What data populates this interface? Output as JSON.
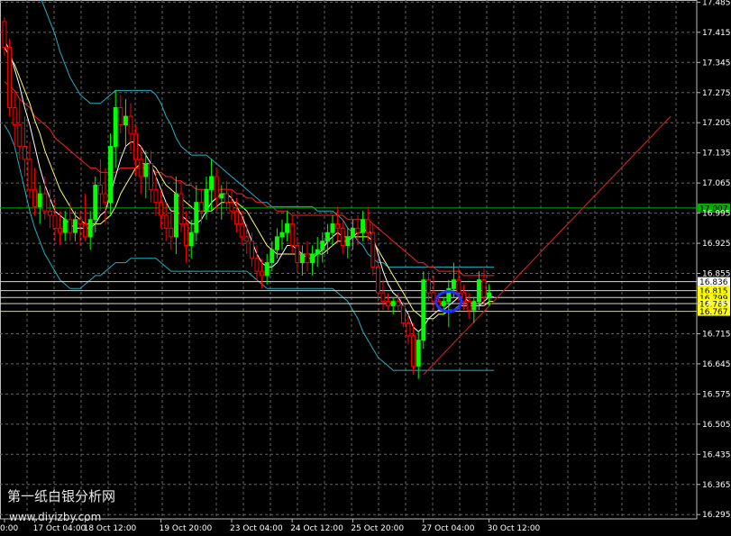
{
  "chart_data": {
    "type": "candlestick",
    "y_ticks": [
      17.485,
      17.415,
      17.345,
      17.275,
      17.205,
      17.135,
      17.065,
      16.995,
      16.925,
      16.855,
      16.785,
      16.715,
      16.645,
      16.575,
      16.505,
      16.435,
      16.365,
      16.295
    ],
    "y_tick_labels": [
      "17.485",
      "17.415",
      "17.345",
      "17.275",
      "17.205",
      "17.135",
      "17.065",
      "16.995",
      "16.925",
      "16.855",
      "16.785",
      "16.715",
      "16.645",
      "16.575",
      "16.505",
      "16.435",
      "16.365",
      "16.295"
    ],
    "ylim": [
      16.285,
      17.49
    ],
    "x_labels": [
      {
        "bar": 0,
        "label": "0:00"
      },
      {
        "bar": 6,
        "label": "17 Oct 04:00"
      },
      {
        "bar": 16,
        "label": "18 Oct 12:00"
      },
      {
        "bar": 31,
        "label": "19 Oct 20:00"
      },
      {
        "bar": 45,
        "label": "23 Oct 04:00"
      },
      {
        "bar": 57,
        "label": "24 Oct 12:00"
      },
      {
        "bar": 69,
        "label": "25 Oct 20:00"
      },
      {
        "bar": 83,
        "label": "27 Oct 04:00"
      },
      {
        "bar": 96,
        "label": "30 Oct 12:00"
      }
    ],
    "candles": [
      [
        17.44,
        17.45,
        17.36,
        17.38
      ],
      [
        17.38,
        17.4,
        17.22,
        17.24
      ],
      [
        17.24,
        17.28,
        17.15,
        17.2
      ],
      [
        17.2,
        17.26,
        17.12,
        17.15
      ],
      [
        17.15,
        17.22,
        17.08,
        17.12
      ],
      [
        17.12,
        17.16,
        17.03,
        17.05
      ],
      [
        17.05,
        17.1,
        16.99,
        17.01
      ],
      [
        17.01,
        17.06,
        16.97,
        17.04
      ],
      [
        17.04,
        17.08,
        16.98,
        17.0
      ],
      [
        17.0,
        17.05,
        16.96,
        16.99
      ],
      [
        16.99,
        17.03,
        16.93,
        16.96
      ],
      [
        16.96,
        17.0,
        16.92,
        16.95
      ],
      [
        16.95,
        17.0,
        16.93,
        16.98
      ],
      [
        16.98,
        17.02,
        16.93,
        16.95
      ],
      [
        16.95,
        17.0,
        16.93,
        16.98
      ],
      [
        16.98,
        17.0,
        16.92,
        16.97
      ],
      [
        16.97,
        17.04,
        16.93,
        16.94
      ],
      [
        16.94,
        17.0,
        16.91,
        16.98
      ],
      [
        16.98,
        17.08,
        16.95,
        17.06
      ],
      [
        17.06,
        17.12,
        17.0,
        17.04
      ],
      [
        17.04,
        17.1,
        16.97,
        17.02
      ],
      [
        17.02,
        17.18,
        16.99,
        17.15
      ],
      [
        17.15,
        17.28,
        17.1,
        17.24
      ],
      [
        17.24,
        17.27,
        17.18,
        17.2
      ],
      [
        17.2,
        17.26,
        17.15,
        17.22
      ],
      [
        17.22,
        17.25,
        17.14,
        17.18
      ],
      [
        17.18,
        17.2,
        17.08,
        17.12
      ],
      [
        17.12,
        17.15,
        17.04,
        17.08
      ],
      [
        17.08,
        17.14,
        17.03,
        17.11
      ],
      [
        17.11,
        17.14,
        17.02,
        17.05
      ],
      [
        17.05,
        17.09,
        16.99,
        17.02
      ],
      [
        17.02,
        17.05,
        16.96,
        16.99
      ],
      [
        16.99,
        17.02,
        16.93,
        16.96
      ],
      [
        16.96,
        17.0,
        16.91,
        16.94
      ],
      [
        16.94,
        17.08,
        16.9,
        17.04
      ],
      [
        17.04,
        17.07,
        16.95,
        16.97
      ],
      [
        16.97,
        17.0,
        16.88,
        16.92
      ],
      [
        16.92,
        16.98,
        16.89,
        16.95
      ],
      [
        16.95,
        17.06,
        16.93,
        17.02
      ],
      [
        17.02,
        17.05,
        16.97,
        17.0
      ],
      [
        17.0,
        17.08,
        16.98,
        17.05
      ],
      [
        17.05,
        17.12,
        17.0,
        17.08
      ],
      [
        17.08,
        17.1,
        17.0,
        17.03
      ],
      [
        17.03,
        17.06,
        16.98,
        17.04
      ],
      [
        17.04,
        17.07,
        17.0,
        17.02
      ],
      [
        17.02,
        17.05,
        16.98,
        17.0
      ],
      [
        17.0,
        17.03,
        16.95,
        16.97
      ],
      [
        16.97,
        17.0,
        16.92,
        16.94
      ],
      [
        16.94,
        16.97,
        16.9,
        16.93
      ],
      [
        16.93,
        16.95,
        16.87,
        16.89
      ],
      [
        16.89,
        16.92,
        16.84,
        16.86
      ],
      [
        16.86,
        16.89,
        16.82,
        16.85
      ],
      [
        16.85,
        16.9,
        16.83,
        16.88
      ],
      [
        16.88,
        16.93,
        16.86,
        16.91
      ],
      [
        16.91,
        16.96,
        16.89,
        16.94
      ],
      [
        16.94,
        16.98,
        16.91,
        16.95
      ],
      [
        16.95,
        17.0,
        16.93,
        16.97
      ],
      [
        16.97,
        16.99,
        16.9,
        16.92
      ],
      [
        16.92,
        16.94,
        16.86,
        16.88
      ],
      [
        16.88,
        16.92,
        16.85,
        16.9
      ],
      [
        16.9,
        16.93,
        16.86,
        16.88
      ],
      [
        16.88,
        16.92,
        16.85,
        16.9
      ],
      [
        16.9,
        16.94,
        16.87,
        16.91
      ],
      [
        16.91,
        16.95,
        16.88,
        16.93
      ],
      [
        16.93,
        16.97,
        16.9,
        16.95
      ],
      [
        16.95,
        16.99,
        16.92,
        16.97
      ],
      [
        16.97,
        17.01,
        16.93,
        16.96
      ],
      [
        16.96,
        16.98,
        16.9,
        16.92
      ],
      [
        16.92,
        16.96,
        16.89,
        16.94
      ],
      [
        16.94,
        16.98,
        16.91,
        16.96
      ],
      [
        16.96,
        16.99,
        16.92,
        16.95
      ],
      [
        16.95,
        17.0,
        16.93,
        16.98
      ],
      [
        16.98,
        17.01,
        16.93,
        16.95
      ],
      [
        16.95,
        16.97,
        16.85,
        16.87
      ],
      [
        16.87,
        16.89,
        16.79,
        16.81
      ],
      [
        16.81,
        16.84,
        16.77,
        16.79
      ],
      [
        16.79,
        16.81,
        16.77,
        16.78
      ],
      [
        16.78,
        16.8,
        16.76,
        16.79
      ],
      [
        16.79,
        16.81,
        16.77,
        16.78
      ],
      [
        16.78,
        16.79,
        16.73,
        16.74
      ],
      [
        16.74,
        16.76,
        16.69,
        16.71
      ],
      [
        16.71,
        16.74,
        16.62,
        16.64
      ],
      [
        16.64,
        16.72,
        16.61,
        16.7
      ],
      [
        16.7,
        16.86,
        16.68,
        16.84
      ],
      [
        16.84,
        16.86,
        16.79,
        16.81
      ],
      [
        16.81,
        16.85,
        16.77,
        16.79
      ],
      [
        16.79,
        16.81,
        16.77,
        16.78
      ],
      [
        16.78,
        16.8,
        16.76,
        16.79
      ],
      [
        16.79,
        16.84,
        16.73,
        16.82
      ],
      [
        16.82,
        16.88,
        16.8,
        16.84
      ],
      [
        16.84,
        16.87,
        16.79,
        16.81
      ],
      [
        16.81,
        16.83,
        16.77,
        16.79
      ],
      [
        16.79,
        16.81,
        16.75,
        16.77
      ],
      [
        16.77,
        16.8,
        16.74,
        16.79
      ],
      [
        16.79,
        16.86,
        16.77,
        16.84
      ],
      [
        16.84,
        16.87,
        16.78,
        16.8
      ],
      [
        16.8,
        16.83,
        16.78,
        16.81
      ]
    ],
    "moving_average_white": [
      17.4,
      17.37,
      17.33,
      17.29,
      17.24,
      17.2,
      17.15,
      17.1,
      17.06,
      17.03,
      17.0,
      16.99,
      16.98,
      16.97,
      16.96,
      16.96,
      16.96,
      16.96,
      16.97,
      16.99,
      17.0,
      17.04,
      17.08,
      17.12,
      17.15,
      17.16,
      17.16,
      17.15,
      17.13,
      17.11,
      17.08,
      17.05,
      17.02,
      17.0,
      17.0,
      16.99,
      16.98,
      16.97,
      16.97,
      16.98,
      17.0,
      17.02,
      17.03,
      17.04,
      17.04,
      17.03,
      17.01,
      16.99,
      16.96,
      16.93,
      16.9,
      16.88,
      16.87,
      16.87,
      16.88,
      16.9,
      16.92,
      16.92,
      16.91,
      16.9,
      16.89,
      16.89,
      16.9,
      16.91,
      16.93,
      16.94,
      16.95,
      16.94,
      16.94,
      16.94,
      16.95,
      16.95,
      16.96,
      16.94,
      16.9,
      16.86,
      16.83,
      16.81,
      16.8,
      16.78,
      16.76,
      16.73,
      16.72,
      16.73,
      16.75,
      16.76,
      16.77,
      16.77,
      16.78,
      16.79,
      16.8,
      16.8,
      16.79,
      16.78,
      16.78,
      16.79,
      16.8,
      16.8
    ],
    "moving_average_yellow": [
      17.38,
      17.36,
      17.34,
      17.31,
      17.28,
      17.25,
      17.21,
      17.18,
      17.14,
      17.11,
      17.08,
      17.05,
      17.03,
      17.01,
      16.99,
      16.98,
      16.97,
      16.97,
      16.97,
      16.97,
      16.98,
      16.99,
      17.01,
      17.04,
      17.06,
      17.08,
      17.1,
      17.11,
      17.11,
      17.11,
      17.1,
      17.08,
      17.06,
      17.05,
      17.04,
      17.03,
      17.02,
      17.01,
      17.0,
      17.0,
      17.0,
      17.0,
      17.01,
      17.02,
      17.02,
      17.02,
      17.02,
      17.01,
      17.0,
      16.98,
      16.96,
      16.94,
      16.92,
      16.91,
      16.9,
      16.9,
      16.9,
      16.9,
      16.9,
      16.9,
      16.9,
      16.9,
      16.9,
      16.9,
      16.91,
      16.92,
      16.93,
      16.93,
      16.93,
      16.94,
      16.94,
      16.94,
      16.94,
      16.93,
      16.91,
      16.89,
      16.87,
      16.85,
      16.83,
      16.81,
      16.79,
      16.77,
      16.76,
      16.75,
      16.75,
      16.75,
      16.76,
      16.76,
      16.77,
      16.77,
      16.78,
      16.78,
      16.78,
      16.78,
      16.78,
      16.78,
      16.79,
      16.79
    ],
    "moving_average_red": [
      17.3,
      17.29,
      17.28,
      17.26,
      17.25,
      17.24,
      17.22,
      17.21,
      17.2,
      17.19,
      17.17,
      17.16,
      17.15,
      17.14,
      17.13,
      17.12,
      17.11,
      17.1,
      17.1,
      17.09,
      17.09,
      17.09,
      17.09,
      17.1,
      17.1,
      17.1,
      17.1,
      17.1,
      17.1,
      17.1,
      17.09,
      17.09,
      17.08,
      17.08,
      17.07,
      17.07,
      17.06,
      17.06,
      17.05,
      17.05,
      17.05,
      17.05,
      17.05,
      17.05,
      17.05,
      17.05,
      17.04,
      17.04,
      17.03,
      17.03,
      17.02,
      17.02,
      17.01,
      17.01,
      17.0,
      17.0,
      17.0,
      16.99,
      16.99,
      16.99,
      16.99,
      16.99,
      16.99,
      16.99,
      16.99,
      16.99,
      16.99,
      16.99,
      16.98,
      16.98,
      16.98,
      16.98,
      16.98,
      16.97,
      16.96,
      16.95,
      16.94,
      16.93,
      16.92,
      16.91,
      16.9,
      16.89,
      16.88,
      16.88,
      16.87,
      16.87,
      16.86,
      16.86,
      16.86,
      16.86,
      16.86,
      16.85,
      16.85,
      16.85,
      16.85,
      16.85,
      16.85,
      16.85
    ],
    "bollinger_upper": [
      17.62,
      17.6,
      17.58,
      17.56,
      17.55,
      17.54,
      17.52,
      17.5,
      17.47,
      17.44,
      17.41,
      17.37,
      17.34,
      17.31,
      17.29,
      17.27,
      17.26,
      17.25,
      17.25,
      17.25,
      17.26,
      17.27,
      17.28,
      17.28,
      17.28,
      17.28,
      17.28,
      17.28,
      17.28,
      17.28,
      17.27,
      17.25,
      17.22,
      17.2,
      17.17,
      17.15,
      17.14,
      17.13,
      17.13,
      17.13,
      17.13,
      17.12,
      17.11,
      17.1,
      17.09,
      17.08,
      17.07,
      17.06,
      17.05,
      17.04,
      17.03,
      17.02,
      17.02,
      17.01,
      17.01,
      17.01,
      17.01,
      17.01,
      17.01,
      17.01,
      17.01,
      17.01,
      17.0,
      17.0,
      17.0,
      17.0,
      16.99,
      16.98,
      16.96,
      16.95,
      16.93,
      16.92,
      16.9,
      16.89,
      16.88,
      16.88,
      16.87,
      16.87,
      16.87,
      16.87,
      16.87,
      16.87,
      16.87,
      16.87,
      16.87,
      16.87,
      16.87,
      16.87,
      16.87,
      16.87,
      16.87,
      16.87,
      16.87,
      16.87,
      16.87,
      16.87,
      16.87,
      16.87
    ],
    "bollinger_lower": [
      17.2,
      17.18,
      17.15,
      17.1,
      17.05,
      17.0,
      16.96,
      16.93,
      16.9,
      16.88,
      16.86,
      16.84,
      16.83,
      16.82,
      16.82,
      16.82,
      16.83,
      16.84,
      16.85,
      16.85,
      16.86,
      16.87,
      16.88,
      16.88,
      16.88,
      16.89,
      16.89,
      16.89,
      16.89,
      16.89,
      16.89,
      16.88,
      16.87,
      16.86,
      16.86,
      16.86,
      16.86,
      16.86,
      16.86,
      16.86,
      16.86,
      16.86,
      16.86,
      16.86,
      16.86,
      16.86,
      16.86,
      16.86,
      16.86,
      16.85,
      16.84,
      16.83,
      16.82,
      16.82,
      16.82,
      16.82,
      16.82,
      16.82,
      16.82,
      16.82,
      16.82,
      16.82,
      16.82,
      16.82,
      16.82,
      16.82,
      16.81,
      16.8,
      16.79,
      16.77,
      16.75,
      16.72,
      16.7,
      16.68,
      16.66,
      16.65,
      16.64,
      16.63,
      16.63,
      16.63,
      16.63,
      16.63,
      16.63,
      16.63,
      16.63,
      16.63,
      16.63,
      16.63,
      16.63,
      16.63,
      16.63,
      16.63,
      16.63,
      16.63,
      16.63,
      16.63,
      16.63,
      16.63
    ],
    "trendline": {
      "x1_bar": 83,
      "y1": 16.62,
      "x2_bar": 132,
      "y2": 17.22
    },
    "horizontal_levels": [
      {
        "price": 17.007,
        "label": "17.007",
        "color": "#00b000",
        "tag_color": "#00b000"
      },
      {
        "price": 16.836,
        "label": "16.836",
        "color": "#d8d8d8",
        "tag_color": "#ffffff"
      },
      {
        "price": 16.815,
        "label": "16.815",
        "color": "#d8d8d8",
        "tag_color": "#ffff00"
      },
      {
        "price": 16.799,
        "label": "16.799",
        "color": "#d8d8d8",
        "tag_color": "#ffff00"
      },
      {
        "price": 16.785,
        "label": "16.785",
        "color": "#d8d8d8",
        "tag_color": "#ffff00"
      },
      {
        "price": 16.767,
        "label": "16.767",
        "color": "#e8e800",
        "tag_color": "#ffff00"
      }
    ],
    "highlight_circle": {
      "bar": 88,
      "price": 16.79
    },
    "colors": {
      "bull": "#00ff00",
      "bear": "#ff0000",
      "ma_white": "#ffffff",
      "ma_yellow": "#ffff66",
      "ma_red": "#ff2020",
      "bands": "#20b0c0",
      "trendline": "#c02020",
      "grid": "#666666",
      "circle": "#2030ff"
    }
  },
  "watermark": {
    "line1": "第一纸白银分析网",
    "line2": "www.diyizby.com"
  }
}
